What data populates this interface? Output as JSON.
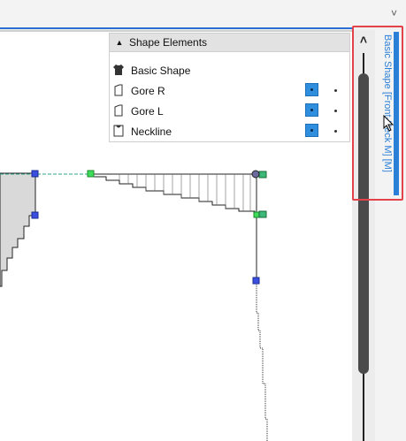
{
  "panel": {
    "title": "Shape Elements",
    "items": [
      {
        "label": "Basic Shape",
        "icon": "shirt-icon"
      },
      {
        "label": "Gore R",
        "icon": "page-icon"
      },
      {
        "label": "Gore L",
        "icon": "page-icon"
      },
      {
        "label": "Neckline",
        "icon": "neckline-icon"
      }
    ]
  },
  "side_tab": {
    "label": "Basic Shape [Front-Neck M] [M]"
  },
  "colors": {
    "accent": "#2a7fd6",
    "highlight": "#e3424b",
    "selected_button": "#2f8fde"
  }
}
